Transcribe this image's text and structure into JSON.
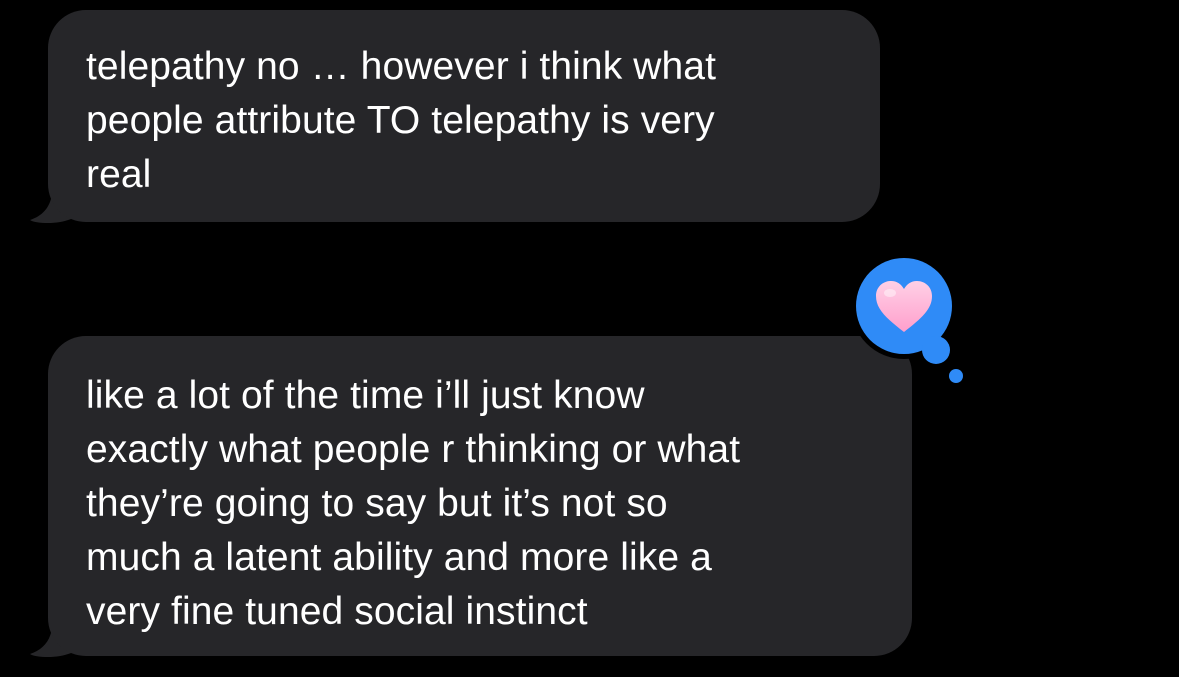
{
  "conversation": {
    "messages": [
      {
        "direction": "incoming",
        "lines": [
          "telepathy no … however i think what",
          "people attribute TO telepathy is very",
          "real"
        ]
      },
      {
        "direction": "incoming",
        "lines": [
          "like a lot of the time i’ll just know",
          "exactly what people r thinking or what",
          "they’re going to say but it’s not so",
          "much a latent ability and more like a",
          "very fine tuned social instinct"
        ],
        "tapback": {
          "icon": "heart-icon",
          "badge_color": "#2f8bf7",
          "heart_color": "#ffb8d9"
        }
      }
    ]
  },
  "colors": {
    "background": "#000000",
    "bubble": "#262629",
    "text": "#ffffff"
  }
}
